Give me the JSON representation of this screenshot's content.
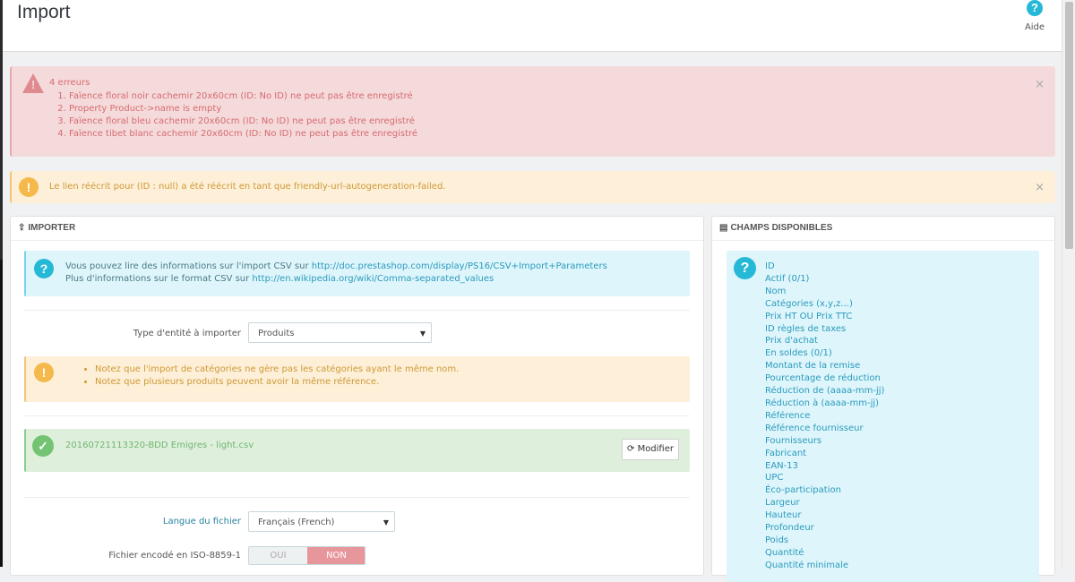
{
  "header": {
    "title": "Import",
    "help_label": "Aide",
    "help_icon": "?"
  },
  "errors": {
    "title": "4 erreurs",
    "items": [
      "Faïence floral noir cachemir 20x60cm (ID: No ID) ne peut pas être enregistré",
      "Property Product->name is empty",
      "Faïence floral bleu cachemir 20x60cm (ID: No ID) ne peut pas être enregistré",
      "Faïence tibet blanc cachemir 20x60cm (ID: No ID) ne peut pas être enregistré"
    ],
    "close": "×"
  },
  "warning": {
    "icon": "!",
    "text": "Le lien réécrit pour (ID : null) a été réécrit en tant que friendly-url-autogeneration-failed.",
    "close": "×"
  },
  "importer": {
    "heading": "IMPORTER",
    "info_icon": "?",
    "info_line1_prefix": "Vous pouvez lire des informations sur l'import CSV sur ",
    "info_line1_link": "http://doc.prestashop.com/display/PS16/CSV+Import+Parameters",
    "info_line2_prefix": "Plus d'informations sur le format CSV sur ",
    "info_line2_link": "http://en.wikipedia.org/wiki/Comma-separated_values",
    "entity_label": "Type d'entité à importer",
    "entity_value": "Produits",
    "notice_icon": "!",
    "notices": [
      "Notez que l'import de catégories ne gère pas les catégories ayant le même nom.",
      "Notez que plusieurs produits peuvent avoir la même référence."
    ],
    "success_icon": "✓",
    "file_name": "20160721113320-BDD Emigres - light.csv",
    "modify_label": "Modifier",
    "language_label": "Langue du fichier",
    "language_value": "Français (French)",
    "iso_label": "Fichier encodé en ISO-8859-1",
    "iso_yes": "OUI",
    "iso_no": "NON",
    "iso_selected": "NON"
  },
  "fields": {
    "heading": "CHAMPS DISPONIBLES",
    "info_icon": "?",
    "items": [
      "ID",
      "Actif (0/1)",
      "Nom",
      "Catégories (x,y,z...)",
      "Prix HT OU Prix TTC",
      "ID règles de taxes",
      "Prix d'achat",
      "En soldes (0/1)",
      "Montant de la remise",
      "Pourcentage de réduction",
      "Réduction de (aaaa-mm-jj)",
      "Réduction à (aaaa-mm-jj)",
      "Référence",
      "Référence fournisseur",
      "Fournisseurs",
      "Fabricant",
      "EAN-13",
      "UPC",
      "Éco-participation",
      "Largeur",
      "Hauteur",
      "Profondeur",
      "Poids",
      "Quantité",
      "Quantité minimale"
    ]
  },
  "colors": {
    "accent": "#25b9d7",
    "danger": "#d56b6f",
    "warning": "#cf9a36",
    "success": "#72b572"
  }
}
